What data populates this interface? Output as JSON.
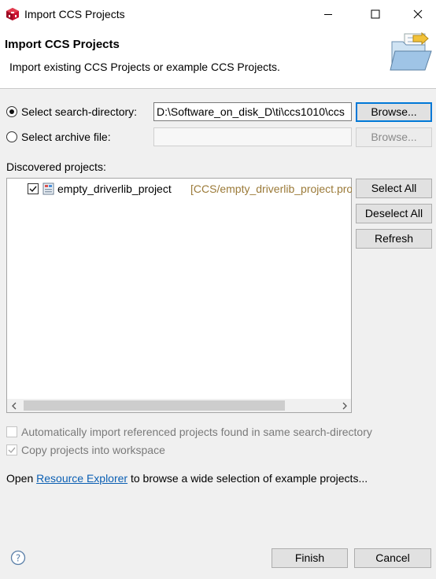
{
  "window": {
    "title": "Import CCS Projects",
    "app_icon": "ccs-cube-icon",
    "controls": [
      "minimize-icon",
      "maximize-icon",
      "close-icon"
    ]
  },
  "header": {
    "title": "Import CCS Projects",
    "description": "Import existing CCS Projects or example CCS Projects.",
    "icon": "import-folder-icon"
  },
  "source": {
    "search_dir_label": "Select search-directory:",
    "search_dir_selected": true,
    "search_dir_value": "D:\\Software_on_disk_D\\ti\\ccs1010\\ccs",
    "browse_label": "Browse...",
    "archive_label": "Select archive file:",
    "archive_value": "",
    "archive_browse_label": "Browse..."
  },
  "projects": {
    "label": "Discovered projects:",
    "items": [
      {
        "name": "empty_driverlib_project",
        "path": "[CCS/empty_driverlib_project.projectspec]",
        "checked": true
      }
    ],
    "select_all_label": "Select All",
    "deselect_all_label": "Deselect All",
    "refresh_label": "Refresh"
  },
  "options": {
    "auto_import_label": "Automatically import referenced projects found in same search-directory",
    "auto_import_checked": false,
    "copy_label": "Copy projects into workspace",
    "copy_checked": true
  },
  "info": {
    "prefix": "Open ",
    "link": "Resource Explorer",
    "suffix": " to browse a wide selection of example projects..."
  },
  "footer": {
    "help_icon": "help-icon",
    "finish_label": "Finish",
    "cancel_label": "Cancel"
  },
  "colors": {
    "link": "#0b5fb3",
    "path_text": "#9b7a38",
    "default_button_border": "#0078d7",
    "app_icon_red": "#c8102e"
  }
}
